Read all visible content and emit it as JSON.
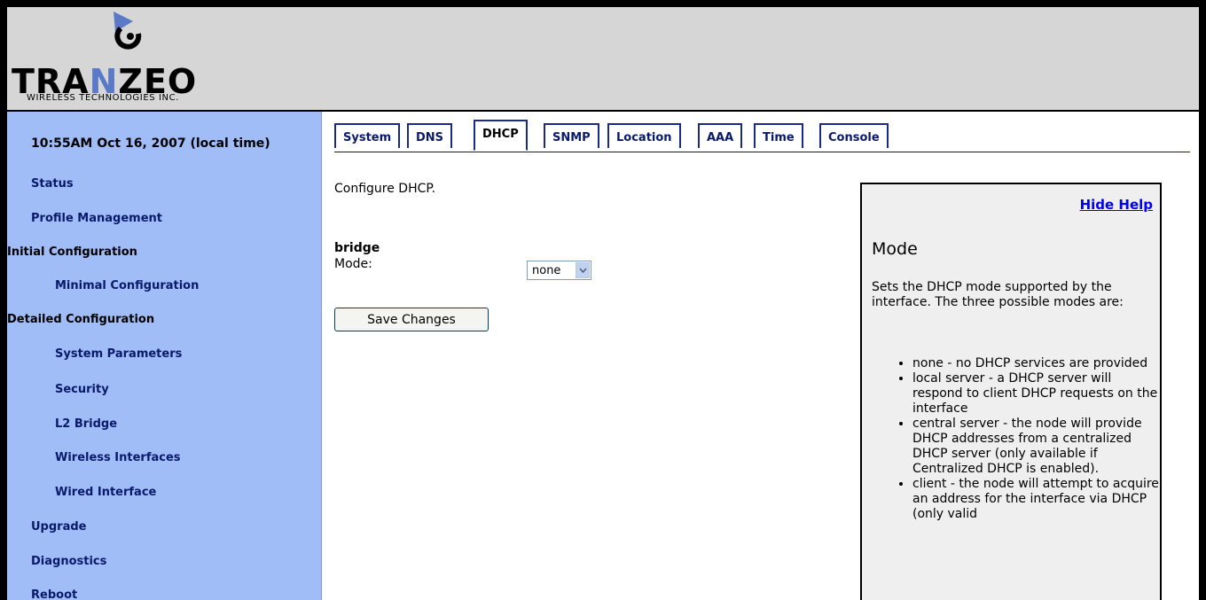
{
  "header": {
    "logo_text_a": "TRA",
    "logo_text_b": "N",
    "logo_text_c": "ZEO",
    "logo_subtitle": "WIRELESS TECHNOLOGIES INC."
  },
  "sidebar": {
    "clock": "10:55AM Oct 16, 2007 (local time)",
    "items": [
      {
        "label": "Status"
      },
      {
        "label": "Profile Management"
      },
      {
        "label": "Initial Configuration"
      },
      {
        "label": "Minimal Configuration"
      },
      {
        "label": "Detailed Configuration"
      },
      {
        "label": "System Parameters"
      },
      {
        "label": "Security"
      },
      {
        "label": "L2 Bridge"
      },
      {
        "label": "Wireless Interfaces"
      },
      {
        "label": "Wired Interface"
      },
      {
        "label": "Upgrade"
      },
      {
        "label": "Diagnostics"
      },
      {
        "label": "Reboot"
      }
    ]
  },
  "tabs": [
    {
      "label": "System"
    },
    {
      "label": "DNS"
    },
    {
      "label": "DHCP",
      "active": true
    },
    {
      "label": "SNMP"
    },
    {
      "label": "Location"
    },
    {
      "label": "AAA"
    },
    {
      "label": "Time"
    },
    {
      "label": "Console"
    }
  ],
  "main": {
    "intro": "Configure DHCP.",
    "section_title": "bridge",
    "mode_label": "Mode:",
    "mode_value": "none",
    "save_label": "Save Changes"
  },
  "help": {
    "hide_label": "Hide Help",
    "title": "Mode",
    "description": "Sets the DHCP mode supported by the interface. The three possible modes are:",
    "items": [
      "none - no DHCP services are provided",
      "local server - a DHCP server will respond to client DHCP requests on the interface",
      "central server - the node will provide DHCP addresses from a centralized DHCP server (only available if Centralized DHCP is enabled).",
      "client - the node will attempt to acquire an address for the interface via DHCP (only valid"
    ]
  },
  "colors": {
    "sidebar_bg": "#a1bdf7",
    "nav_link": "#0a1a6b",
    "header_bg": "#d6d6d6",
    "help_bg": "#efefef",
    "logo_accent": "#5a7ac8"
  }
}
